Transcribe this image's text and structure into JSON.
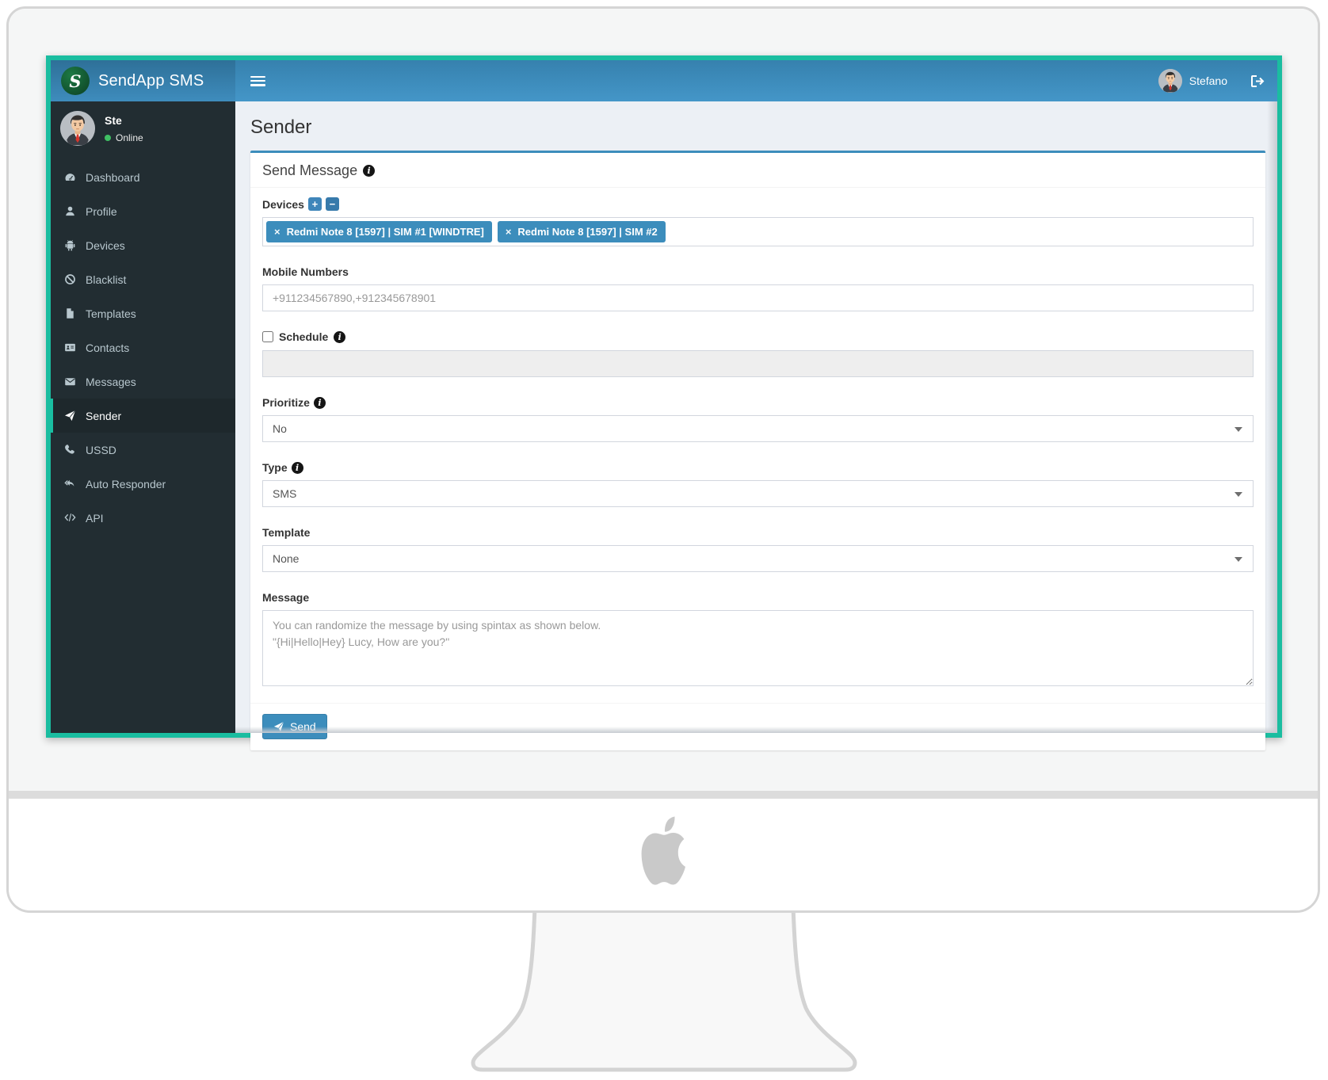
{
  "app": {
    "title": "SendApp SMS",
    "logo_letter": "S"
  },
  "navbar": {
    "user_name": "Stefano"
  },
  "sidebar": {
    "user": {
      "name": "Ste",
      "status": "Online"
    },
    "items": [
      {
        "label": "Dashboard"
      },
      {
        "label": "Profile"
      },
      {
        "label": "Devices"
      },
      {
        "label": "Blacklist"
      },
      {
        "label": "Templates"
      },
      {
        "label": "Contacts"
      },
      {
        "label": "Messages"
      },
      {
        "label": "Sender"
      },
      {
        "label": "USSD"
      },
      {
        "label": "Auto Responder"
      },
      {
        "label": "API"
      }
    ],
    "active_item": "Sender"
  },
  "page": {
    "title": "Sender"
  },
  "form": {
    "box_title": "Send Message",
    "devices": {
      "label": "Devices",
      "tags": [
        {
          "label": "Redmi Note 8 [1597] | SIM #1 [WINDTRE]"
        },
        {
          "label": "Redmi Note 8 [1597] | SIM #2"
        }
      ]
    },
    "mobile_numbers": {
      "label": "Mobile Numbers",
      "placeholder": "+911234567890,+912345678901",
      "value": ""
    },
    "schedule": {
      "label": "Schedule",
      "checked": false,
      "value": ""
    },
    "prioritize": {
      "label": "Prioritize",
      "value": "No"
    },
    "type": {
      "label": "Type",
      "value": "SMS"
    },
    "template": {
      "label": "Template",
      "value": "None"
    },
    "message": {
      "label": "Message",
      "placeholder": "You can randomize the message by using spintax as shown below.\n\"{Hi|Hello|Hey} Lucy, How are you?\"",
      "value": ""
    },
    "send_label": "Send"
  },
  "icons": {
    "info": "i",
    "plus": "+",
    "minus": "−",
    "remove": "×"
  },
  "colors": {
    "frame_teal": "#1abda0",
    "navbar_blue": "#3c8dbc",
    "logo_panel_blue": "#367fa9",
    "logo_green": "#11522d",
    "sidebar_dark": "#222d32",
    "active_item_bg": "#1e282c",
    "accent_blue": "#3c8dbc",
    "online_green": "#3fbf63",
    "content_bg": "#ecf0f5"
  }
}
